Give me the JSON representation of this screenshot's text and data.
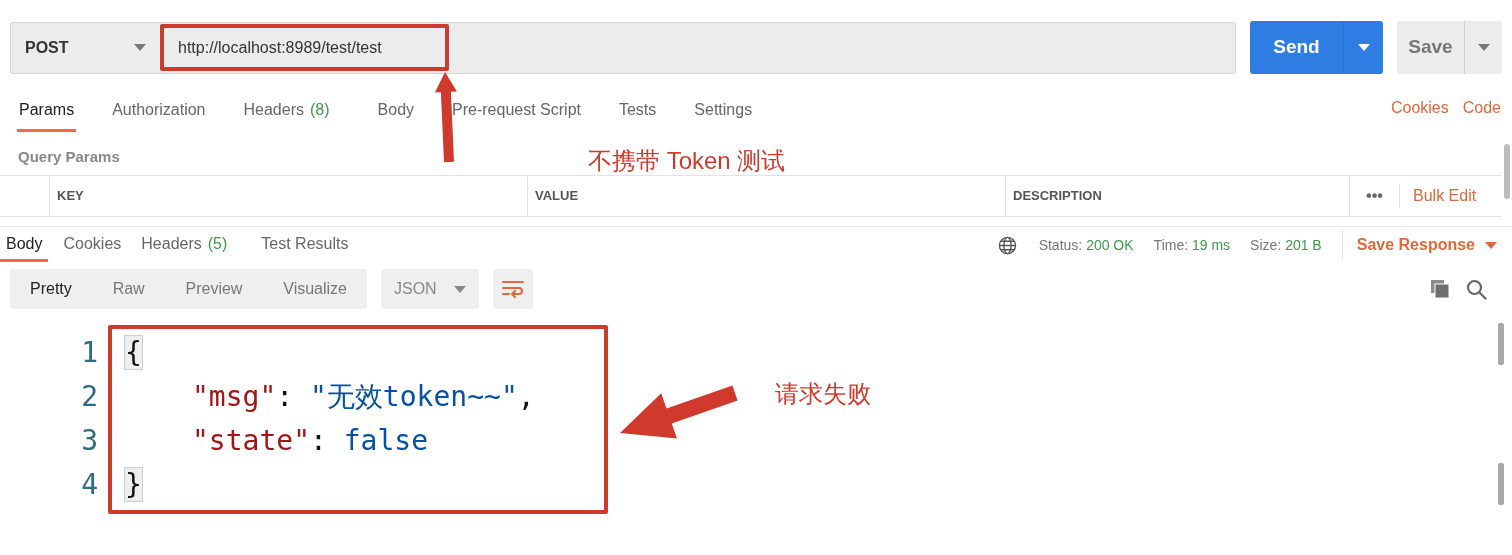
{
  "request": {
    "method": "POST",
    "url": "http://localhost:8989/test/test",
    "send": "Send",
    "save": "Save"
  },
  "request_tabs": [
    {
      "label": "Params",
      "selected": true
    },
    {
      "label": "Authorization",
      "selected": false
    },
    {
      "label": "Headers",
      "count": "(8)",
      "selected": false
    },
    {
      "label": "Body",
      "selected": false
    },
    {
      "label": "Pre-request Script",
      "selected": false
    },
    {
      "label": "Tests",
      "selected": false
    },
    {
      "label": "Settings",
      "selected": false
    }
  ],
  "links": [
    "Cookies",
    "Code"
  ],
  "params": {
    "title": "Query Params",
    "columns": [
      "KEY",
      "VALUE",
      "DESCRIPTION"
    ],
    "more": "•••",
    "bulk_edit": "Bulk Edit"
  },
  "response_tabs": [
    {
      "label": "Body",
      "selected": true
    },
    {
      "label": "Cookies",
      "selected": false
    },
    {
      "label": "Headers",
      "count": "(5)",
      "selected": false
    },
    {
      "label": "Test Results",
      "selected": false
    }
  ],
  "stats": [
    {
      "label": "Status:",
      "value": "200 OK"
    },
    {
      "label": "Time:",
      "value": "19 ms"
    },
    {
      "label": "Size:",
      "value": "201 B"
    }
  ],
  "save_response": "Save Response",
  "view_modes": [
    {
      "label": "Pretty",
      "selected": true
    },
    {
      "label": "Raw",
      "selected": false
    },
    {
      "label": "Preview",
      "selected": false
    },
    {
      "label": "Visualize",
      "selected": false
    }
  ],
  "format": "JSON",
  "code": [
    {
      "number": "1",
      "tokens": [
        {
          "kind": "brace",
          "text": "{"
        }
      ]
    },
    {
      "number": "2",
      "tokens": [
        {
          "kind": "key",
          "text": "\"msg\""
        },
        {
          "kind": "punct",
          "text": ": "
        },
        {
          "kind": "string",
          "text": "\"无效token~~\""
        },
        {
          "kind": "punct",
          "text": ","
        }
      ]
    },
    {
      "number": "3",
      "tokens": [
        {
          "kind": "key",
          "text": "\"state\""
        },
        {
          "kind": "punct",
          "text": ": "
        },
        {
          "kind": "literal",
          "text": "false"
        }
      ]
    },
    {
      "number": "4",
      "tokens": [
        {
          "kind": "brace",
          "text": "}"
        }
      ]
    }
  ],
  "annotations": {
    "url_note": "不携带 Token 测试",
    "response_note": "请求失败"
  }
}
